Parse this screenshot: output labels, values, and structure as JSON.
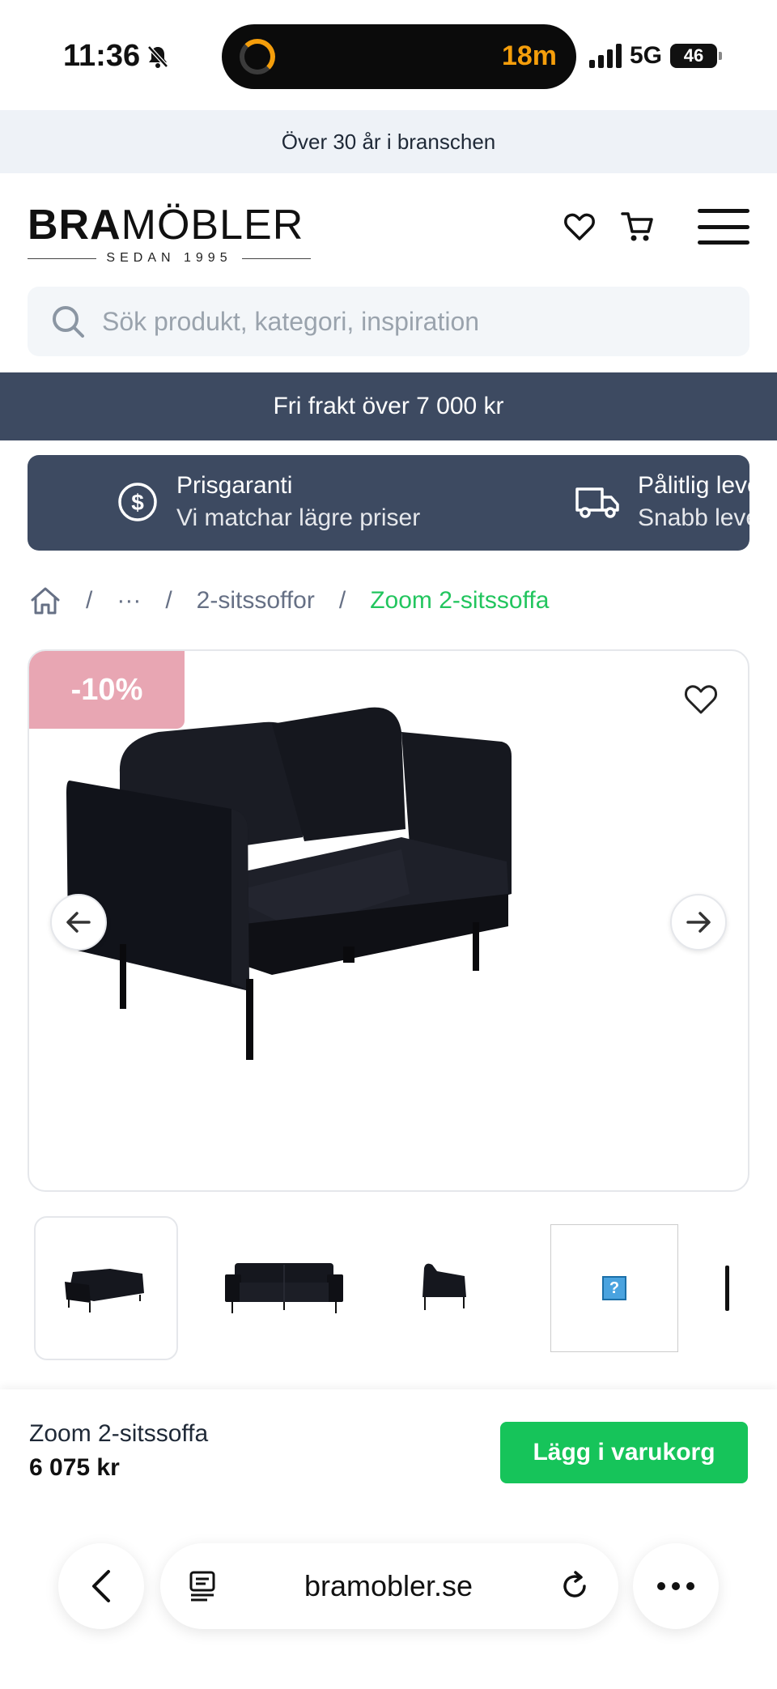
{
  "status_bar": {
    "time": "11:36",
    "activity": "18m",
    "network": "5G",
    "battery": "46"
  },
  "announcement": "Över 30 år i branschen",
  "brand": {
    "word_bold": "BRA",
    "word_light": "MÖBLER",
    "tagline": "SEDAN 1995"
  },
  "search": {
    "placeholder": "Sök produkt, kategori, inspiration"
  },
  "shipping_banner": "Fri frakt över 7 000 kr",
  "usps": [
    {
      "title": "Prisgaranti",
      "subtitle": "Vi matchar lägre priser",
      "icon": "dollar-icon"
    },
    {
      "title": "Pålitlig leverans",
      "subtitle": "Snabb leverans",
      "icon": "truck-icon"
    }
  ],
  "breadcrumb": {
    "ellipsis": "···",
    "category": "2-sitssoffor",
    "current": "Zoom 2-sitssoffa"
  },
  "product": {
    "discount_badge": "-10%",
    "name": "Zoom 2-sitssoffa",
    "price": "6 075 kr",
    "add_to_cart": "Lägg i varukorg"
  },
  "thumbnail_placeholder": "?",
  "browser": {
    "url": "bramobler.se"
  },
  "colors": {
    "accent_green": "#16c45a",
    "breadcrumb_green": "#22c55e",
    "navy_banner": "#3d4a61",
    "badge_pink": "#e8a6b3"
  }
}
